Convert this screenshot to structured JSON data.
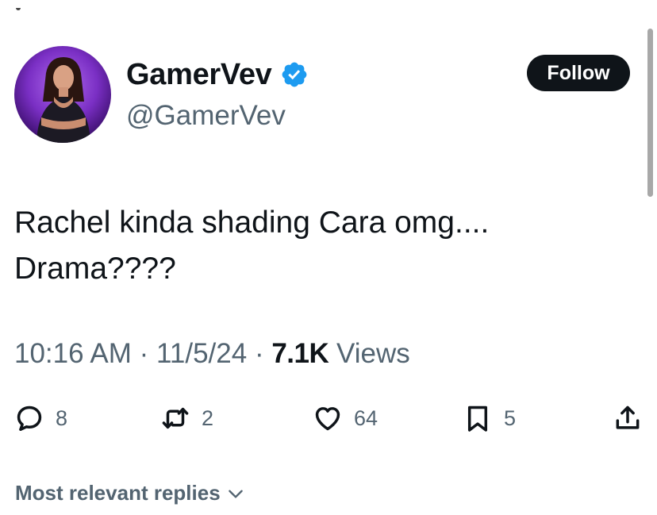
{
  "user": {
    "display_name": "GamerVev",
    "handle": "@GamerVev",
    "verified": true
  },
  "follow_button": {
    "label": "Follow"
  },
  "tweet": {
    "lines": [
      "Rachel kinda shading Cara omg....",
      "Drama????"
    ]
  },
  "meta": {
    "time": "10:16 AM",
    "date": "11/5/24",
    "separator": "·",
    "views_count": "7.1K",
    "views_label": "Views"
  },
  "actions": {
    "replies": "8",
    "reposts": "2",
    "likes": "64",
    "bookmarks": "5"
  },
  "replies_filter": {
    "label": "Most relevant replies"
  },
  "colors": {
    "text": "#0f1419",
    "secondary": "#536471",
    "verified": "#1d9bf0",
    "follow_bg": "#0f1419"
  },
  "icons": [
    "verified-badge-icon",
    "reply-icon",
    "repost-icon",
    "like-icon",
    "bookmark-icon",
    "share-icon",
    "chevron-down-icon"
  ]
}
